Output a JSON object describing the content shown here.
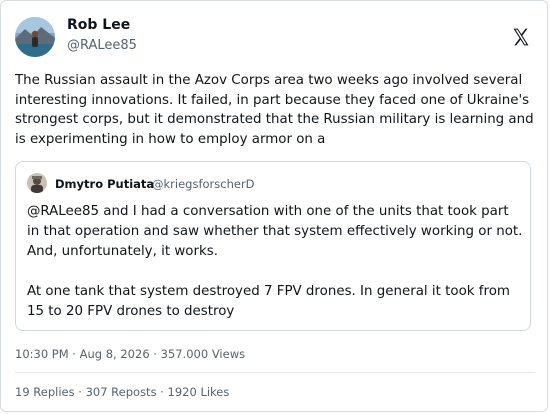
{
  "author": {
    "name": "Rob Lee",
    "handle": "@RALee85"
  },
  "tweet": {
    "text": "The Russian assault in the Azov Corps area two weeks ago involved several interesting innovations. It failed, in part because they faced one of Ukraine's strongest corps, but it demonstrated that the Russian military is learning and is experimenting in how to employ armor on a"
  },
  "quote": {
    "name": "Dmytro Putiata",
    "handle": "@kriegsforscherD",
    "paragraph1": "@RALee85 and I had a conversation with one of the units that took part in that operation and saw whether that system effectively working or not. And, unfortunately, it works.",
    "paragraph2": "At one tank that system destroyed 7 FPV drones. In general it took from 15 to 20 FPV drones to destroy"
  },
  "meta": {
    "time": "10:30 PM",
    "date": "Aug 8, 2026",
    "views": "357.000 Views"
  },
  "stats": {
    "replies": "19 Replies",
    "reposts": "307 Reposts",
    "likes": "1920 Likes"
  },
  "separator": " · ",
  "icons": {
    "brand": "x-logo-icon",
    "avatar": "profile-photo",
    "quote_avatar": "profile-photo"
  }
}
